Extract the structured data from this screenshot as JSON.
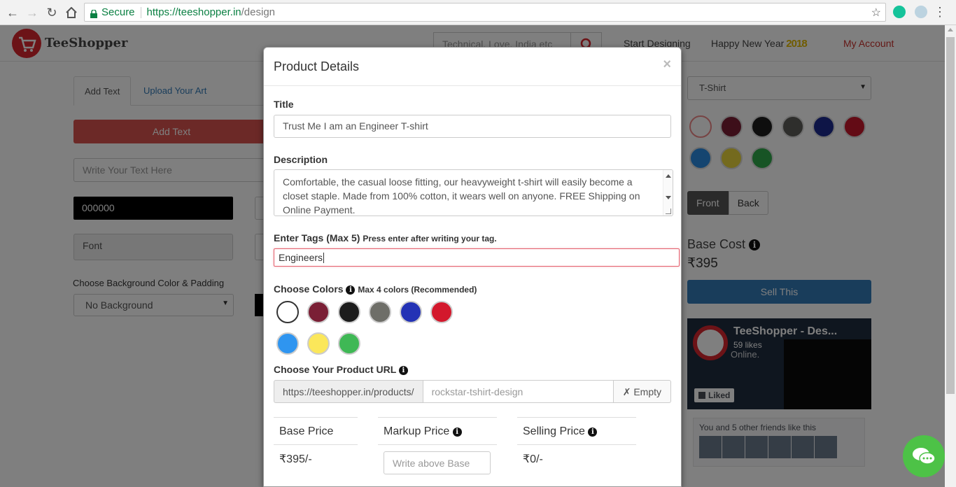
{
  "browser": {
    "secure_label": "Secure",
    "url_scheme_host": "https://teeshopper.in",
    "url_path": "/design"
  },
  "site": {
    "logo_text": "TeeShopper",
    "search_placeholder": "Technical, Love, India etc",
    "nav": {
      "start_designing": "Start Designing",
      "happy_new_year": "Happy New Year",
      "year_badge": "2018",
      "my_account": "My Account"
    },
    "tabs": [
      "Add Text",
      "Upload Your Art"
    ],
    "add_text_button": "Add Text",
    "text_input_placeholder": "Write Your Text Here",
    "color_value": "000000",
    "font_placeholder": "Font",
    "bg_label": "Choose Background Color & Padding",
    "bg_select": "No Background"
  },
  "right_panel": {
    "product_type": "T-Shirt",
    "swatch_colors": [
      "#ffffff",
      "#7a1f35",
      "#1c1c1c",
      "#5c5c58",
      "#1c2b8f",
      "#c7162b",
      "#2a8ae0",
      "#e8d43c",
      "#2ea84a"
    ],
    "front_label": "Front",
    "back_label": "Back",
    "base_cost_label": "Base Cost",
    "base_cost_value": "₹395",
    "sell_button": "Sell This",
    "fb": {
      "page_name": "TeeShopper - Des...",
      "likes": "59 likes",
      "sub_line": "Online.",
      "liked_label": "Liked",
      "friends_text": "You and 5 other friends like this"
    }
  },
  "modal": {
    "title": "Product Details",
    "close": "×",
    "title_label": "Title",
    "title_value": "Trust Me I am an Engineer T-shirt",
    "description_label": "Description",
    "description_value": "Comfortable, the casual loose fitting, our heavyweight t-shirt will easily become a closet staple. Made from 100% cotton, it wears well on anyone. FREE Shipping on Online Payment.",
    "tags_label": "Enter Tags (Max 5)",
    "tags_hint": "Press enter after writing your tag.",
    "tags_value": "Engineers",
    "colors_label": "Choose Colors",
    "colors_hint": "Max 4 colors (Recommended)",
    "colors": [
      "#ffffff",
      "#7a1f35",
      "#1c1c1c",
      "#6e6e68",
      "#2332b5",
      "#d3182c",
      "#2f95f0",
      "#fbe75a",
      "#3fb855"
    ],
    "url_label": "Choose Your Product URL",
    "url_prefix": "https://teeshopper.in/products/",
    "url_placeholder": "rockstar-tshirt-design",
    "url_empty_button": "✗ Empty",
    "base_price_label": "Base Price",
    "base_price_value": "₹395/-",
    "markup_price_label": "Markup Price",
    "markup_placeholder": "Write above Base",
    "selling_price_label": "Selling Price",
    "selling_price_value": "₹0/-"
  }
}
